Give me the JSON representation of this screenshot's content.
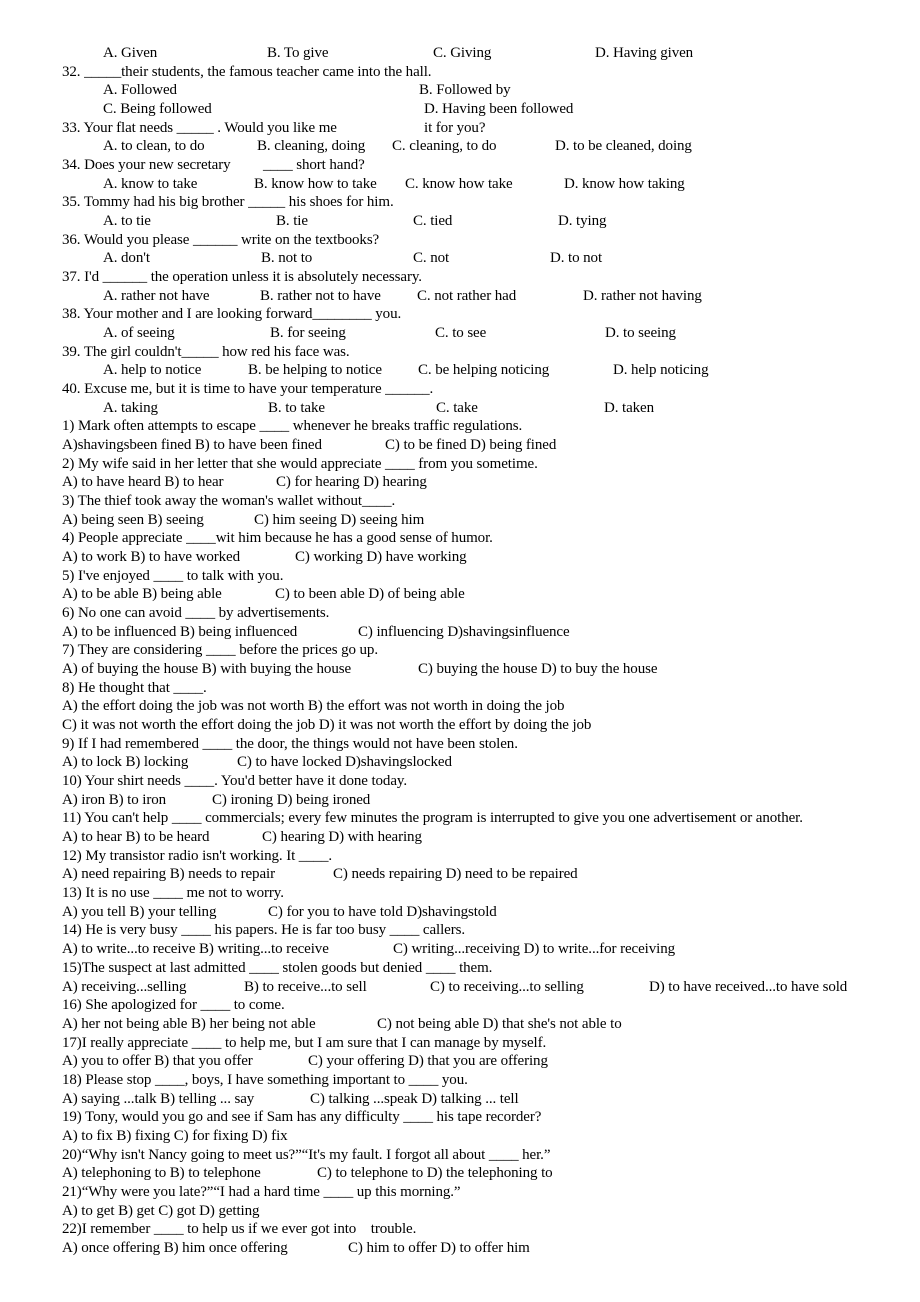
{
  "section1": {
    "continued_options": [
      "A. Given",
      "B. To give",
      "C. Giving",
      "D. Having given"
    ],
    "questions": [
      {
        "q": [
          "32. _____their students, the famous teacher came into the hall."
        ],
        "opts": [
          [
            "A. Followed",
            "B. Followed by"
          ],
          [
            "C. Being followed",
            "D. Having been followed"
          ]
        ]
      },
      {
        "q": [
          "33. Your flat needs _____ . Would you like me",
          "it for you?"
        ],
        "opts": [
          [
            "A. to clean, to do",
            "B. cleaning, doing",
            "C. cleaning, to do",
            "D. to be cleaned, doing"
          ]
        ]
      },
      {
        "q": [
          "34. Does your new secretary",
          "____ short hand?"
        ],
        "opts": [
          [
            "A. know to take",
            "B. know how to take",
            "C. know how take",
            "D. know how taking"
          ]
        ]
      },
      {
        "q": [
          "35. Tommy had his big brother _____ his shoes for him."
        ],
        "opts": [
          [
            "A. to tie",
            "B. tie",
            "C. tied",
            "D. tying"
          ]
        ]
      },
      {
        "q": [
          "36. Would you please ______ write on the textbooks?"
        ],
        "opts": [
          [
            "A. don't",
            "B. not to",
            "C. not",
            "D. to not"
          ]
        ]
      },
      {
        "q": [
          "37. I'd ______ the operation unless it is absolutely necessary."
        ],
        "opts": [
          [
            "A. rather not have",
            "B. rather not to have",
            "C. not rather had",
            "D. rather not having"
          ]
        ]
      },
      {
        "q": [
          "38. Your mother and I are looking forward________ you."
        ],
        "opts": [
          [
            "A. of seeing",
            "B. for seeing",
            "C. to see",
            "D. to seeing"
          ]
        ]
      },
      {
        "q": [
          "39. The girl couldn't_____ how red his face was."
        ],
        "opts": [
          [
            "A. help to notice",
            "B. be helping to notice",
            "C. be helping noticing",
            "D. help noticing"
          ]
        ]
      },
      {
        "q": [
          "40. Excuse me, but it is time to have your temperature ______."
        ],
        "opts": [
          [
            "A. taking",
            "B. to take",
            "C. take",
            "D. taken"
          ]
        ]
      }
    ]
  },
  "section2": {
    "questions": [
      {
        "q": [
          "1) Mark often attempts to escape ____ whenever he breaks traffic regulations."
        ],
        "opts": [
          [
            "A)shavingsbeen fined B) to have been fined",
            "C) to be fined D) being fined"
          ]
        ]
      },
      {
        "q": [
          "2) My wife said in her letter that she would appreciate ____ from you sometime."
        ],
        "opts": [
          [
            "A) to have heard B) to hear",
            "C) for hearing D) hearing"
          ]
        ]
      },
      {
        "q": [
          "3) The thief took away the woman's wallet without____."
        ],
        "opts": [
          [
            "A) being seen B) seeing",
            "C) him seeing D) seeing him"
          ]
        ]
      },
      {
        "q": [
          "4) People appreciate ____wit him because he has a good sense of humor."
        ],
        "opts": [
          [
            "A) to work B) to have worked",
            "C) working D) have working"
          ]
        ]
      },
      {
        "q": [
          "5) I've enjoyed ____ to talk with you."
        ],
        "opts": [
          [
            "A) to be able B) being able",
            "C) to been able D) of being able"
          ]
        ]
      },
      {
        "q": [
          "6) No one can avoid ____ by advertisements."
        ],
        "opts": [
          [
            "A) to be influenced B) being influenced",
            "C) influencing D)shavingsinfluence"
          ]
        ]
      },
      {
        "q": [
          "7) They are considering ____ before the prices go up."
        ],
        "opts": [
          [
            "A) of buying the house B) with buying the house",
            "C) buying the house D) to buy the house"
          ]
        ]
      },
      {
        "q": [
          "8) He thought that ____."
        ],
        "opts": [
          [
            "A) the effort doing the job was not worth B) the effort was not worth in doing the job"
          ],
          [
            "C) it was not worth the effort doing the job D) it was not worth the effort by doing the job"
          ]
        ]
      },
      {
        "q": [
          "9) If I had remembered ____ the door, the things would not have been stolen."
        ],
        "opts": [
          [
            "A) to lock B) locking",
            "C) to have locked D)shavingslocked"
          ]
        ]
      },
      {
        "q": [
          "10) Your shirt needs ____. You'd better have it done today."
        ],
        "opts": [
          [
            "A) iron B) to iron",
            "C) ironing D) being ironed"
          ]
        ]
      },
      {
        "q": [
          "11) You can't help ____ commercials; every few minutes the program is interrupted to give you one advertisement or another."
        ],
        "opts": [
          [
            "A) to hear B) to be heard",
            "C) hearing D) with hearing"
          ]
        ]
      },
      {
        "q": [
          "12) My transistor radio isn't working. It ____."
        ],
        "opts": [
          [
            "A) need repairing B) needs to repair",
            "C) needs repairing D) need to be repaired"
          ]
        ]
      },
      {
        "q": [
          "13) It is no use ____ me not to worry."
        ],
        "opts": [
          [
            "A) you tell B) your telling",
            "C) for you to have told D)shavingstold"
          ]
        ]
      },
      {
        "q": [
          "14) He is very busy ____ his papers. He is far too busy ____ callers."
        ],
        "opts": [
          [
            "A) to write...to receive B) writing...to receive",
            "C) writing...receiving D) to write...for receiving"
          ]
        ]
      },
      {
        "q": [
          "15)The suspect at last admitted ____ stolen goods but denied ____ them."
        ],
        "opts": [
          [
            "A) receiving...selling",
            "B) to receive...to sell",
            "C) to receiving...to selling",
            "D) to have received...to have sold"
          ]
        ]
      },
      {
        "q": [
          "16) She apologized for ____ to come."
        ],
        "opts": [
          [
            "A) her not being able B) her being not able",
            "C) not being able D) that she's not able to"
          ]
        ]
      },
      {
        "q": [
          "17)I really appreciate ____ to help me, but I am sure that I can manage by myself."
        ],
        "opts": [
          [
            "A) you to offer B) that you offer",
            "C) your offering D) that you are offering"
          ]
        ]
      },
      {
        "q": [
          "18) Please stop ____, boys, I have something important to ____ you."
        ],
        "opts": [
          [
            "A) saying ...talk B) telling ... say",
            "C) talking ...speak D) talking ... tell"
          ]
        ]
      },
      {
        "q": [
          "19) Tony, would you go and see if Sam has any difficulty ____ his tape recorder?"
        ],
        "opts": [
          [
            "A) to fix B) fixing C) for fixing D) fix"
          ]
        ]
      },
      {
        "q": [
          "20)“Why isn't Nancy going to meet us?”“It's my fault. I forgot all about ____ her.”"
        ],
        "opts": [
          [
            "A) telephoning to B) to telephone",
            "C) to telephone to D) the telephoning to"
          ]
        ]
      },
      {
        "q": [
          "21)“Why were you late?”“I had a hard time ____ up this morning.”"
        ],
        "opts": [
          [
            "A) to get B) get C) got D) getting"
          ]
        ]
      },
      {
        "q": [
          "22)I remember ____ to help us if we ever got into    trouble."
        ],
        "opts": [
          [
            "A) once offering B) him once offering",
            "C) him to offer D) to offer him"
          ]
        ]
      }
    ]
  }
}
